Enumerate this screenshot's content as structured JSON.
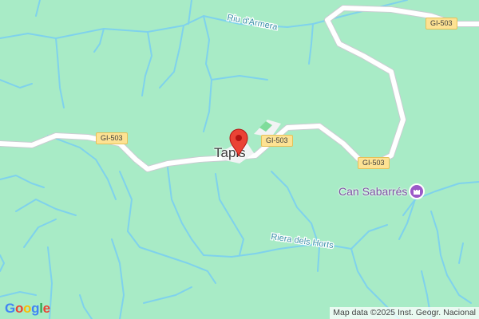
{
  "map": {
    "town_label": "Tapis",
    "road_shields": [
      "GI-503",
      "GI-503",
      "GI-503",
      "GI-503"
    ],
    "rivers": [
      "Riu d'Armera",
      "Riera dels Horts"
    ],
    "poi": {
      "name": "Can Sabarrés",
      "icon": "castle-icon"
    },
    "marker": "location-pin-icon",
    "colors": {
      "land": "#a8ebc6",
      "water": "#7fd2ec",
      "road": "#ffffff",
      "marker": "#ea4335",
      "poi": "#9b59c8"
    }
  },
  "brand": {
    "logo": "Google"
  },
  "attribution": "Map data ©2025 Inst. Geogr. Nacional"
}
